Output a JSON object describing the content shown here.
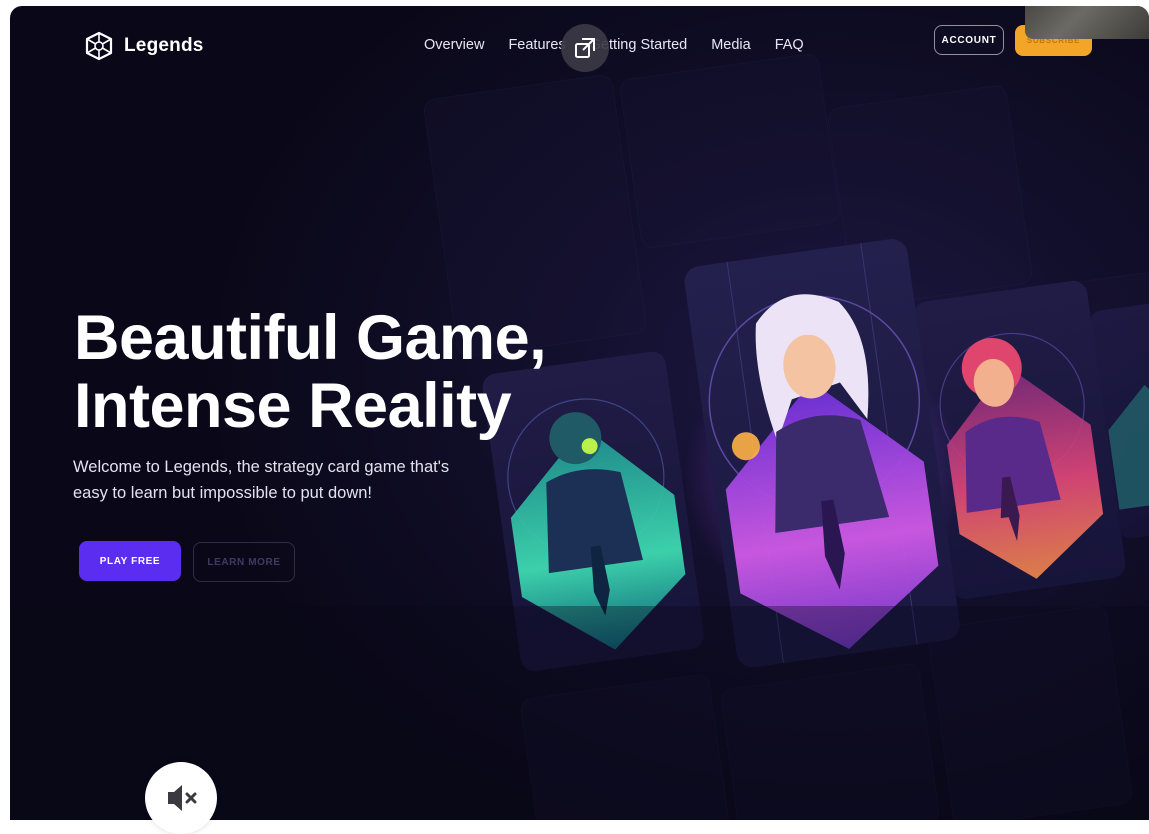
{
  "brand": {
    "name": "Legends"
  },
  "nav": {
    "items": [
      "Overview",
      "Features",
      "Getting Started",
      "Media",
      "FAQ"
    ]
  },
  "header": {
    "account_label": "ACCOUNT",
    "subscribe_label": "SUBSCRIBE"
  },
  "hero": {
    "title_line1": "Beautiful Game,",
    "title_line2": "Intense Reality",
    "subtitle": "Welcome to Legends, the strategy card game that's easy to learn but impossible to put down!",
    "play_label": "PLAY FREE",
    "learn_label": "LEARN MORE"
  },
  "colors": {
    "accent": "#5b2df0",
    "subscribe": "#f2a526",
    "background": "#0a0818"
  },
  "icons": {
    "logo": "legends-logo-icon",
    "popout": "popout-icon",
    "mute": "speaker-mute-icon"
  }
}
